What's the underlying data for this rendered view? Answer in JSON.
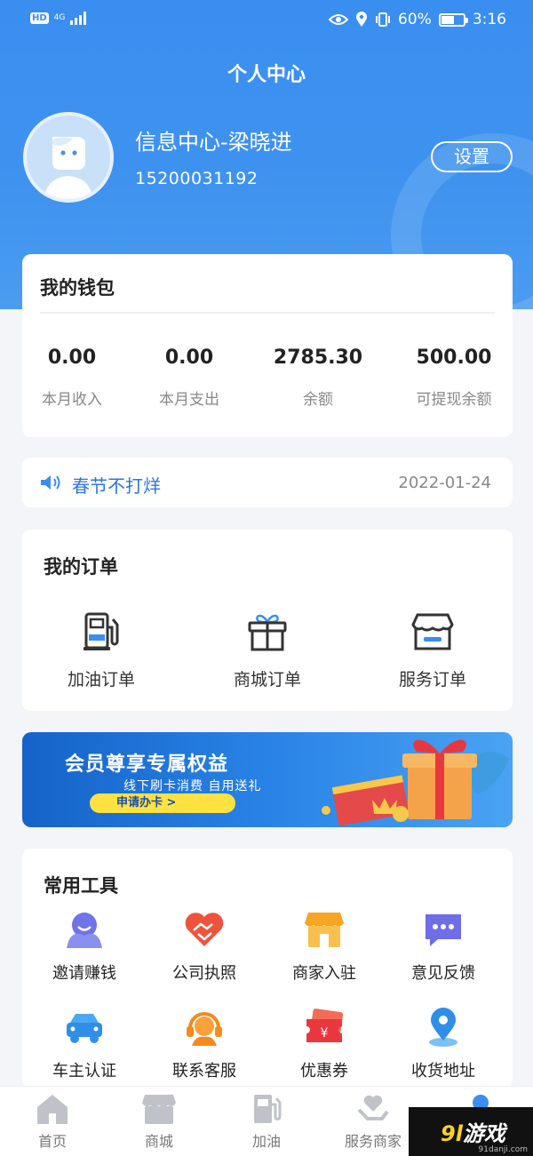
{
  "status_bar": {
    "hd": "HD",
    "net": "4G",
    "battery": "60%",
    "battery_level": 0.6,
    "time": "3:16"
  },
  "header": {
    "title": "个人中心",
    "username": "信息中心-梁晓进",
    "phone": "15200031192",
    "settings_label": "设置"
  },
  "wallet": {
    "title": "我的钱包",
    "stats": [
      {
        "value": "0.00",
        "label": "本月收入"
      },
      {
        "value": "0.00",
        "label": "本月支出"
      },
      {
        "value": "2785.30",
        "label": "余额"
      },
      {
        "value": "500.00",
        "label": "可提现余额"
      }
    ]
  },
  "notice": {
    "text": "春节不打烊",
    "date": "2022-01-24"
  },
  "orders": {
    "title": "我的订单",
    "items": [
      {
        "label": "加油订单",
        "icon": "fuel-pump-icon"
      },
      {
        "label": "商城订单",
        "icon": "gift-box-icon"
      },
      {
        "label": "服务订单",
        "icon": "storefront-icon"
      }
    ]
  },
  "banner": {
    "main": "会员尊享专属权益",
    "sub": "线下刷卡消费 自用送礼",
    "cta": "申请办卡 >"
  },
  "tools": {
    "title": "常用工具",
    "items": [
      {
        "label": "邀请赚钱",
        "icon": "invite-icon"
      },
      {
        "label": "公司执照",
        "icon": "handshake-icon"
      },
      {
        "label": "商家入驻",
        "icon": "shop-icon"
      },
      {
        "label": "意见反馈",
        "icon": "chat-bubble-icon"
      },
      {
        "label": "车主认证",
        "icon": "car-icon"
      },
      {
        "label": "联系客服",
        "icon": "headset-icon"
      },
      {
        "label": "优惠券",
        "icon": "coupon-icon"
      },
      {
        "label": "收货地址",
        "icon": "location-pin-icon"
      }
    ]
  },
  "tabbar": {
    "items": [
      {
        "label": "首页",
        "icon": "home-icon"
      },
      {
        "label": "商城",
        "icon": "store-icon"
      },
      {
        "label": "加油",
        "icon": "fuel-icon"
      },
      {
        "label": "服务商家",
        "icon": "heart-hand-icon"
      },
      {
        "label": "",
        "icon": "profile-icon"
      }
    ]
  },
  "watermark": {
    "brand_num": "9l",
    "brand_text": "游戏",
    "url": "91danji.com"
  },
  "colors": {
    "primary": "#3a8ef0",
    "link": "#2f74d8",
    "accent_yellow": "#ffe140"
  }
}
